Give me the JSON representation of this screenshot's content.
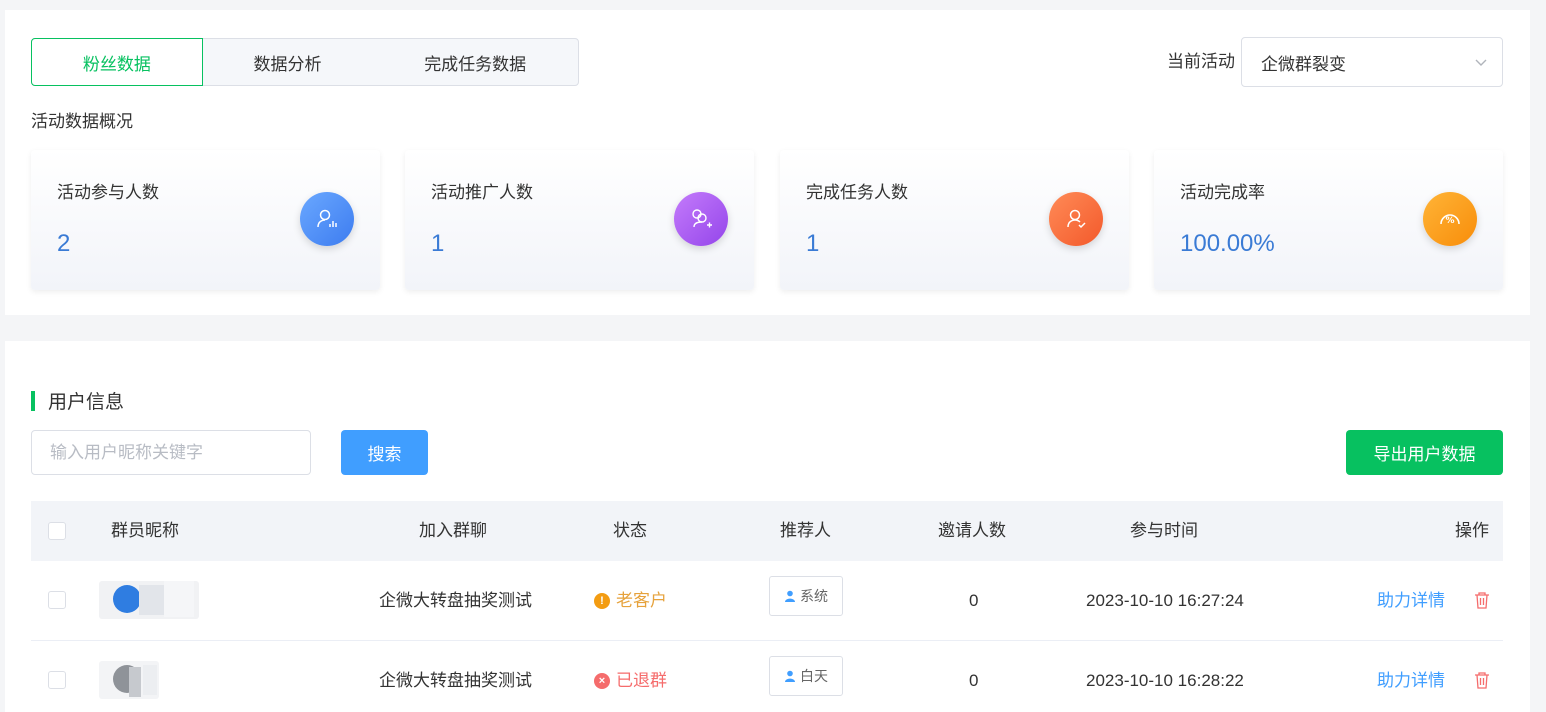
{
  "tabs": [
    {
      "label": "粉丝数据",
      "active": true
    },
    {
      "label": "数据分析",
      "active": false
    },
    {
      "label": "完成任务数据",
      "active": false
    }
  ],
  "current_activity": {
    "label": "当前活动",
    "selected": "企微群裂变"
  },
  "overview_title": "活动数据概况",
  "stats": [
    {
      "title": "活动参与人数",
      "value": "2",
      "icon": "user-chart-icon",
      "color": "#4d8ef7"
    },
    {
      "title": "活动推广人数",
      "value": "1",
      "icon": "user-add-icon",
      "color": "#a25ef0"
    },
    {
      "title": "完成任务人数",
      "value": "1",
      "icon": "user-check-icon",
      "color": "#fa6a3c"
    },
    {
      "title": "活动完成率",
      "value": "100.00%",
      "icon": "percent-gauge-icon",
      "color": "#fb9b13"
    }
  ],
  "user_section": {
    "title": "用户信息",
    "search_placeholder": "输入用户昵称关键字",
    "search_button": "搜索",
    "export_button": "导出用户数据"
  },
  "table": {
    "headers": [
      "群员昵称",
      "加入群聊",
      "状态",
      "推荐人",
      "邀请人数",
      "参与时间",
      "操作"
    ],
    "rows": [
      {
        "group": "企微大转盘抽奖测试",
        "status": "老客户",
        "status_type": "warning",
        "referrer": "系统",
        "invites": "0",
        "time": "2023-10-10 16:27:24",
        "action": "助力详情"
      },
      {
        "group": "企微大转盘抽奖测试",
        "status": "已退群",
        "status_type": "danger",
        "referrer": "白天",
        "invites": "0",
        "time": "2023-10-10 16:28:22",
        "action": "助力详情"
      }
    ]
  }
}
